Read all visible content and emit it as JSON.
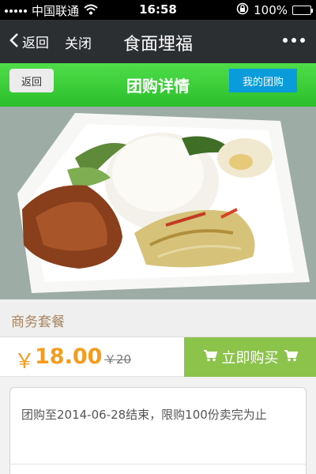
{
  "status_bar": {
    "carrier": "中国联通",
    "time": "16:58",
    "battery": "100%",
    "battery_level": 1.0
  },
  "nav": {
    "back_label": "返回",
    "close_label": "关闭",
    "title": "食面埋福"
  },
  "header": {
    "back_label": "返回",
    "title": "团购详情",
    "my_groupbuy_label": "我的团购"
  },
  "product": {
    "name": "商务套餐",
    "currency": "￥",
    "price": "18.00",
    "original_price": "￥20",
    "buy_label": "立即购买"
  },
  "info": {
    "text": "团购至2014-06-28结束，限购100份卖完为止"
  },
  "icons": {
    "wifi": "wifi-icon",
    "lock": "rotation-lock-icon",
    "cart": "cart-icon",
    "more": "more-icon"
  },
  "colors": {
    "green_header": "#38c936",
    "buy_button": "#8cc34b",
    "price": "#f39c1e",
    "my_groupbuy": "#0a9bdb",
    "nav_bg": "#2c2f31"
  }
}
